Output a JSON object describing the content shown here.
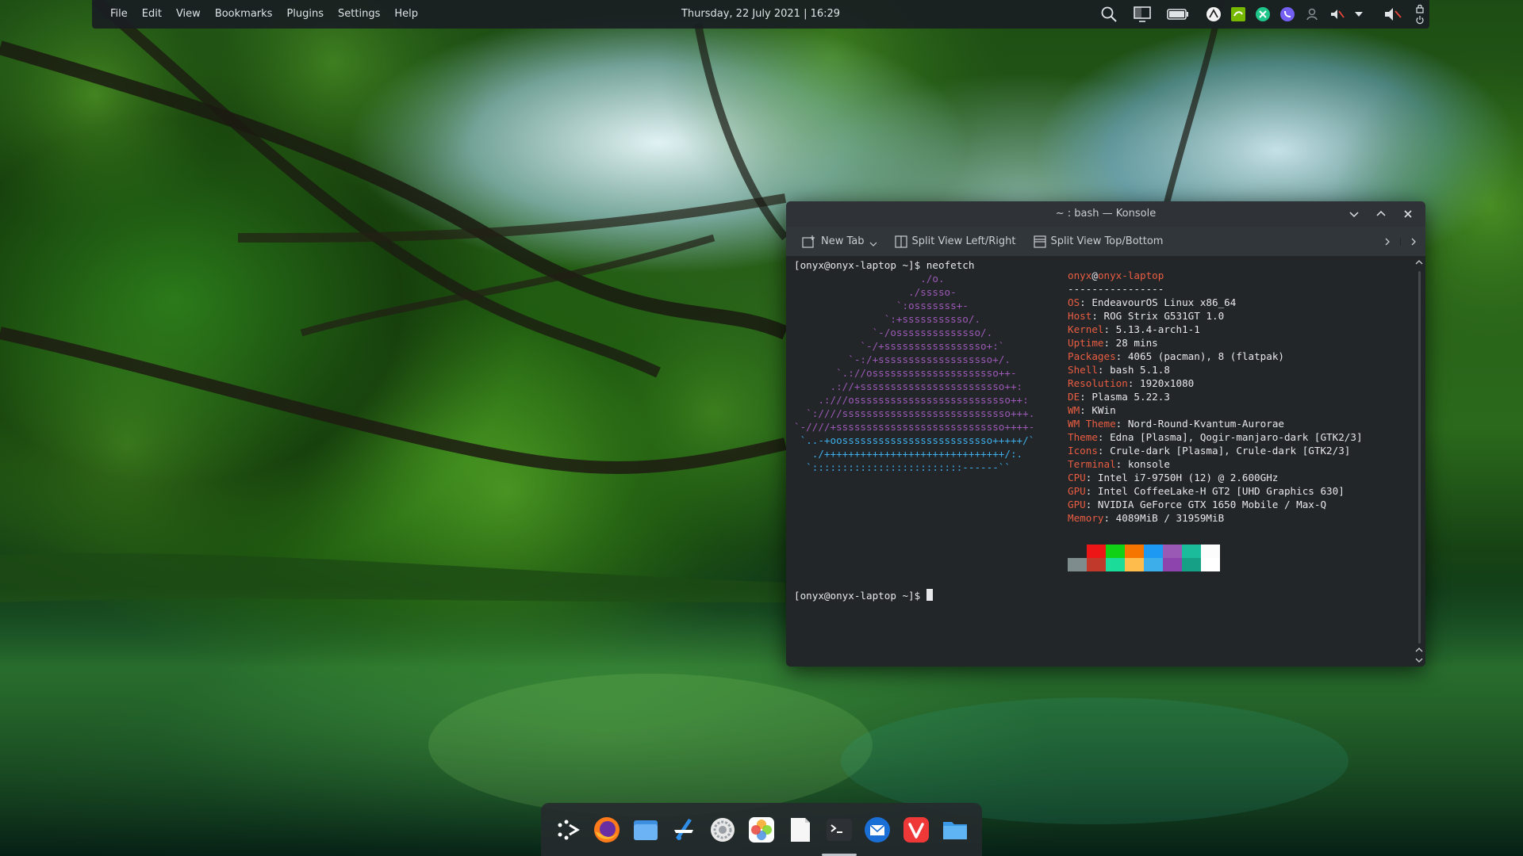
{
  "panel": {
    "menu": [
      "File",
      "Edit",
      "View",
      "Bookmarks",
      "Plugins",
      "Settings",
      "Help"
    ],
    "clock": "Thursday, 22 July 2021 | 16:29",
    "tray_icons": [
      "search-icon",
      "display-configuration-icon",
      "battery-icon",
      "unknown-app-icon",
      "nvidia-icon",
      "vpn-icon",
      "viber-icon",
      "user-switch-icon",
      "mute-microphone-icon",
      "expand-tray-icon",
      "volume-icon",
      "lock-screen-icon",
      "power-icon"
    ]
  },
  "konsole": {
    "title": "~ : bash — Konsole",
    "toolbar": {
      "new_tab": "New Tab",
      "split_lr": "Split View Left/Right",
      "split_tb": "Split View Top/Bottom"
    },
    "prompt_first": "[onyx@onyx-laptop ~]$ neofetch",
    "prompt_last": "[onyx@onyx-laptop ~]$ ",
    "logo_lines": [
      "                     ./o.",
      "                   ./sssso-",
      "                 `:osssssss+-",
      "               `:+sssssssssso/.",
      "             `-/ossssssssssssso/.",
      "           `-/+sssssssssssssssso+:`",
      "         `-:/+sssssssssssssssssso+/.",
      "       `.://osssssssssssssssssssso++-",
      "      .://+ssssssssssssssssssssssso++:",
      "    .:///ossssssssssssssssssssssssso++:",
      "  `:////ssssssssssssssssssssssssssso+++.",
      "`-////+ssssssssssssssssssssssssssso++++-",
      " `..-+oosssssssssssssssssssssssso+++++/`",
      "   ./++++++++++++++++++++++++++++++/:.",
      "  `:::::::::::::::::::::::::------``"
    ],
    "user": "onyx",
    "at": "@",
    "host": "onyx-laptop",
    "separator": "----------------",
    "info": [
      {
        "key": "OS",
        "value": "EndeavourOS Linux x86_64"
      },
      {
        "key": "Host",
        "value": "ROG Strix G531GT 1.0"
      },
      {
        "key": "Kernel",
        "value": "5.13.4-arch1-1"
      },
      {
        "key": "Uptime",
        "value": "28 mins"
      },
      {
        "key": "Packages",
        "value": "4065 (pacman), 8 (flatpak)"
      },
      {
        "key": "Shell",
        "value": "bash 5.1.8"
      },
      {
        "key": "Resolution",
        "value": "1920x1080"
      },
      {
        "key": "DE",
        "value": "Plasma 5.22.3"
      },
      {
        "key": "WM",
        "value": "KWin"
      },
      {
        "key": "WM Theme",
        "value": "Nord-Round-Kvantum-Aurorae"
      },
      {
        "key": "Theme",
        "value": "Edna [Plasma], Qogir-manjaro-dark [GTK2/3]"
      },
      {
        "key": "Icons",
        "value": "Crule-dark [Plasma], Crule-dark [GTK2/3]"
      },
      {
        "key": "Terminal",
        "value": "konsole"
      },
      {
        "key": "CPU",
        "value": "Intel i7-9750H (12) @ 2.600GHz"
      },
      {
        "key": "GPU",
        "value": "Intel CoffeeLake-H GT2 [UHD Graphics 630]"
      },
      {
        "key": "GPU",
        "value": "NVIDIA GeForce GTX 1650 Mobile / Max-Q"
      },
      {
        "key": "Memory",
        "value": "4089MiB / 31959MiB"
      }
    ],
    "palette": [
      [
        "#232629",
        "#7f8c8d"
      ],
      [
        "#ed1515",
        "#c0392b"
      ],
      [
        "#11d116",
        "#1cdc9a"
      ],
      [
        "#f67400",
        "#fdbc4b"
      ],
      [
        "#1d99f3",
        "#3daee9"
      ],
      [
        "#9b59b6",
        "#8e44ad"
      ],
      [
        "#1abc9c",
        "#16a085"
      ],
      [
        "#fcfcfc",
        "#ffffff"
      ]
    ],
    "colors": {
      "logo_purple": "#9b59b6",
      "logo_blue": "#3daee9",
      "key_red": "#e95d42"
    }
  },
  "dock": {
    "items": [
      {
        "name": "application-launcher-icon"
      },
      {
        "name": "firefox-icon"
      },
      {
        "name": "files-icon"
      },
      {
        "name": "store-icon"
      },
      {
        "name": "system-settings-icon"
      },
      {
        "name": "photos-icon"
      },
      {
        "name": "text-editor-icon"
      },
      {
        "name": "terminal-icon"
      },
      {
        "name": "thunderbird-icon"
      },
      {
        "name": "vivaldi-icon"
      },
      {
        "name": "folder-icon"
      }
    ]
  }
}
